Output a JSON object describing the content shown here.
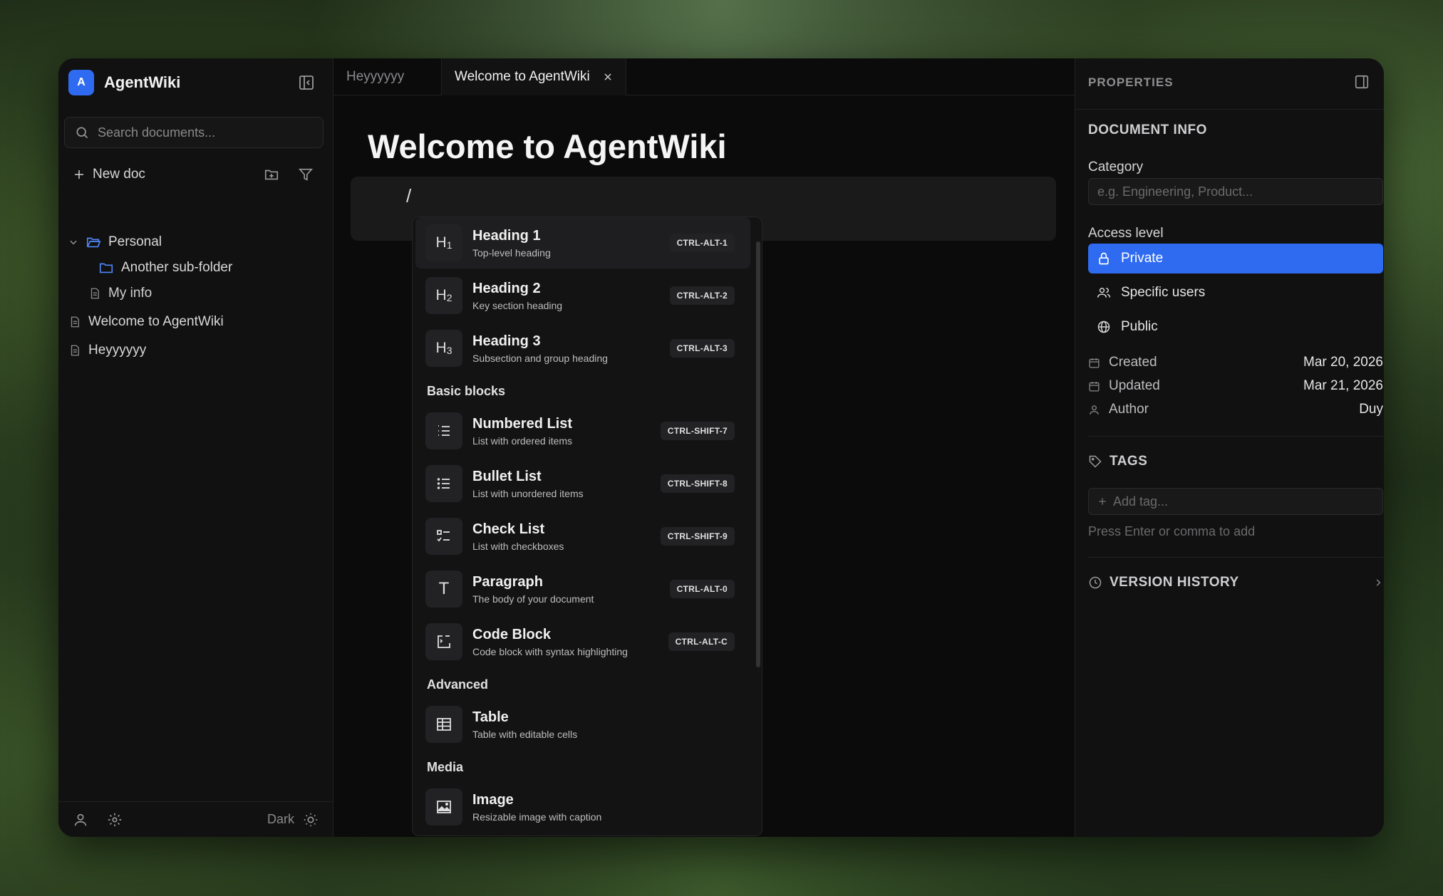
{
  "app": {
    "logo_letter": "A",
    "name": "AgentWiki",
    "accent": "#2f6bf0"
  },
  "sidebar": {
    "search_placeholder": "Search documents...",
    "new_doc_label": "New doc",
    "tree": [
      {
        "label": "Personal",
        "type": "folder-open",
        "level": 0
      },
      {
        "label": "Another sub-folder",
        "type": "folder",
        "level": 1
      },
      {
        "label": "My info",
        "type": "doc",
        "level": 1
      },
      {
        "label": "Welcome to AgentWiki",
        "type": "doc",
        "level": 0
      },
      {
        "label": "Heyyyyyy",
        "type": "doc",
        "level": 0
      }
    ],
    "theme_label": "Dark"
  },
  "tabs": [
    {
      "label": "Heyyyyyy",
      "active": false
    },
    {
      "label": "Welcome to AgentWiki",
      "active": true
    }
  ],
  "editor": {
    "title": "Welcome to AgentWiki",
    "input_text": "/"
  },
  "slash_menu": {
    "items": [
      {
        "title": "Heading 1",
        "sub": "Top-level heading",
        "kbd": "CTRL-ALT-1",
        "icon": "H1"
      },
      {
        "title": "Heading 2",
        "sub": "Key section heading",
        "kbd": "CTRL-ALT-2",
        "icon": "H2"
      },
      {
        "title": "Heading 3",
        "sub": "Subsection and group heading",
        "kbd": "CTRL-ALT-3",
        "icon": "H3"
      },
      {
        "title": "Numbered List",
        "sub": "List with ordered items",
        "kbd": "CTRL-SHIFT-7",
        "icon": "numbered-list-icon"
      },
      {
        "title": "Bullet List",
        "sub": "List with unordered items",
        "kbd": "CTRL-SHIFT-8",
        "icon": "bullet-list-icon"
      },
      {
        "title": "Check List",
        "sub": "List with checkboxes",
        "kbd": "CTRL-SHIFT-9",
        "icon": "check-list-icon"
      },
      {
        "title": "Paragraph",
        "sub": "The body of your document",
        "kbd": "CTRL-ALT-0",
        "icon": "T"
      },
      {
        "title": "Code Block",
        "sub": "Code block with syntax highlighting",
        "kbd": "CTRL-ALT-C",
        "icon": "code-block-icon"
      },
      {
        "title": "Table",
        "sub": "Table with editable cells",
        "kbd": "",
        "icon": "table-icon"
      },
      {
        "title": "Image",
        "sub": "Resizable image with caption",
        "kbd": "",
        "icon": "image-icon"
      }
    ],
    "sections": {
      "basic": "Basic blocks",
      "advanced": "Advanced",
      "media": "Media"
    }
  },
  "properties": {
    "header": "PROPERTIES",
    "doc_info_title": "DOCUMENT INFO",
    "category_label": "Category",
    "category_placeholder": "e.g. Engineering, Product...",
    "access_label": "Access level",
    "access_options": [
      "Private",
      "Specific users",
      "Public"
    ],
    "meta": [
      {
        "label": "Created",
        "value": "Mar 20, 2026"
      },
      {
        "label": "Updated",
        "value": "Mar 21, 2026"
      },
      {
        "label": "Author",
        "value": "Duy"
      }
    ],
    "tags_title": "TAGS",
    "tag_placeholder": "Add tag...",
    "tag_hint": "Press Enter or comma to add",
    "version_history": "VERSION HISTORY"
  }
}
